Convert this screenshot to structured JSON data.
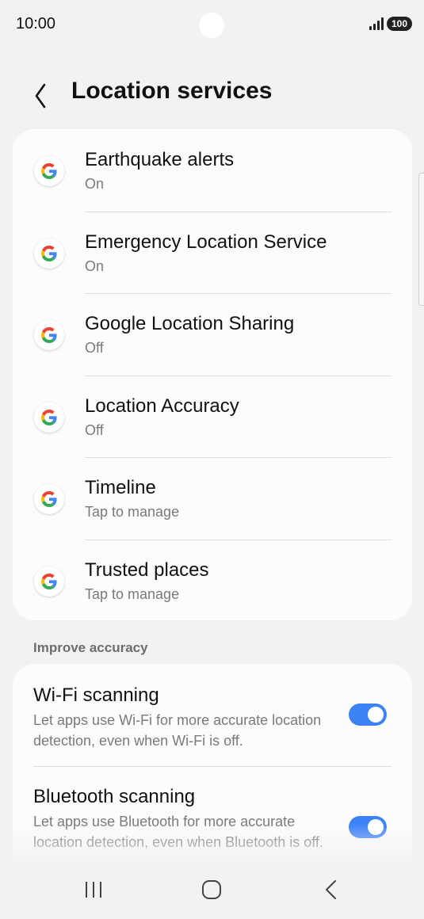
{
  "status_bar": {
    "time": "10:00",
    "battery": "100"
  },
  "header": {
    "title": "Location services"
  },
  "services": [
    {
      "title": "Earthquake alerts",
      "status": "On"
    },
    {
      "title": "Emergency Location Service",
      "status": "On"
    },
    {
      "title": "Google Location Sharing",
      "status": "Off"
    },
    {
      "title": "Location Accuracy",
      "status": "Off"
    },
    {
      "title": "Timeline",
      "status": "Tap to manage"
    },
    {
      "title": "Trusted places",
      "status": "Tap to manage"
    }
  ],
  "improve_accuracy": {
    "section_label": "Improve accuracy",
    "wifi": {
      "title": "Wi-Fi scanning",
      "description": "Let apps use Wi-Fi for more accurate location detection, even when Wi-Fi is off.",
      "enabled": true
    },
    "bluetooth": {
      "title": "Bluetooth scanning",
      "description": "Let apps use Bluetooth for more accurate location detection, even when Bluetooth is off.",
      "enabled": true
    }
  },
  "colors": {
    "accent": "#3e82f7",
    "background": "#f2f2f2",
    "card": "#fcfcfc"
  },
  "icons": {
    "service": "google-g-icon",
    "back": "chevron-left-icon",
    "nav_recents": "recents-icon",
    "nav_home": "home-icon",
    "nav_back": "back-icon"
  }
}
